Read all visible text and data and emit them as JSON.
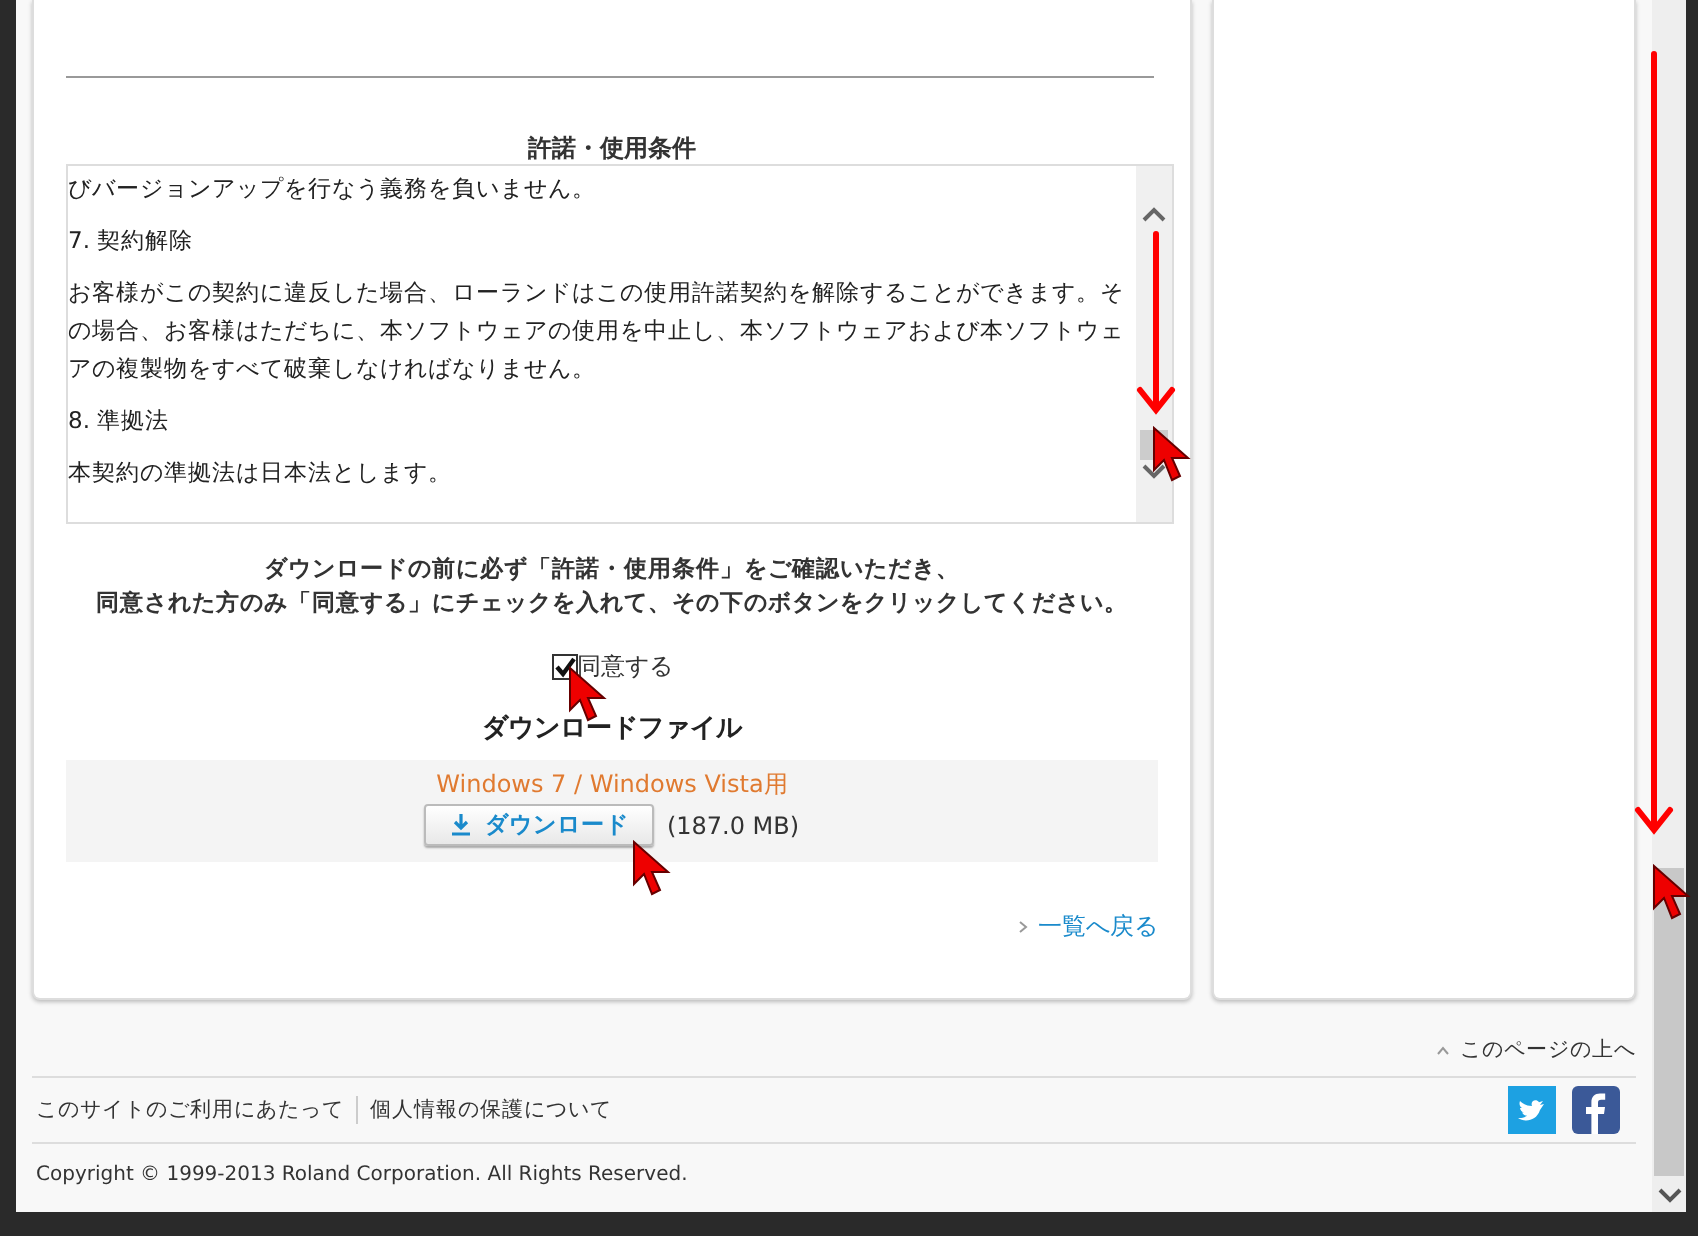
{
  "terms": {
    "title": "許諾・使用条件",
    "paragraphs": [
      "びバージョンアップを行なう義務を負いません。",
      "7. 契約解除",
      "お客様がこの契約に違反した場合、ローランドはこの使用許諾契約を解除することができます。その場合、お客様はただちに、本ソフトウェアの使用を中止し、本ソフトウェアおよび本ソフトウェアの複製物をすべて破棄しなければなりません。",
      "8. 準拠法",
      "本契約の準拠法は日本法とします。"
    ]
  },
  "notice": [
    "ダウンロードの前に必ず「許諾・使用条件」をご確認いただき、",
    "同意された方のみ「同意する」にチェックを入れて、その下のボタンをクリックしてください。"
  ],
  "agree": {
    "label": "同意する",
    "checked": true
  },
  "download": {
    "title": "ダウンロードファイル",
    "files": [
      {
        "platform": "Windows 7 / Windows Vista用",
        "button": "ダウンロード",
        "size": "(187.0 MB)"
      }
    ]
  },
  "back_link": "一覧へ戻る",
  "footer": {
    "page_top": "このページの上へ",
    "links": [
      "このサイトのご利用にあたって",
      "個人情報の保護について"
    ],
    "copyright": "Copyright © 1999-2013 Roland Corporation. All Rights Reserved."
  }
}
